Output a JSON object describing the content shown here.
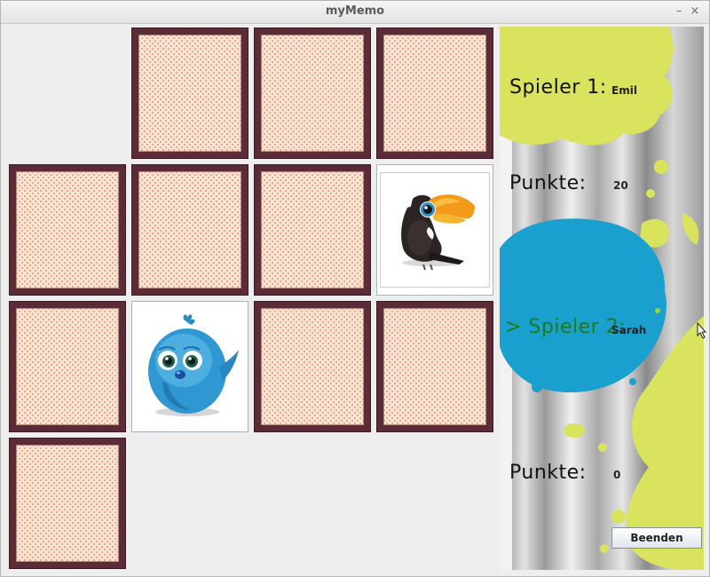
{
  "window": {
    "title": "myMemo",
    "minimize_label": "–",
    "close_label": "×"
  },
  "board": {
    "cards": [
      {
        "id": "r0c1",
        "state": "hidden"
      },
      {
        "id": "r0c2",
        "state": "hidden"
      },
      {
        "id": "r0c3",
        "state": "hidden"
      },
      {
        "id": "r1c0",
        "state": "hidden"
      },
      {
        "id": "r1c1",
        "state": "hidden"
      },
      {
        "id": "r1c2",
        "state": "hidden"
      },
      {
        "id": "r1c3",
        "state": "revealed",
        "image": "toucan-icon"
      },
      {
        "id": "r2c0",
        "state": "hidden"
      },
      {
        "id": "r2c1",
        "state": "revealed",
        "image": "blue-bird-icon"
      },
      {
        "id": "r2c2",
        "state": "hidden"
      },
      {
        "id": "r2c3",
        "state": "hidden"
      },
      {
        "id": "r3c0",
        "state": "hidden"
      }
    ]
  },
  "scoreboard": {
    "player1": {
      "label": "Spieler 1:",
      "name": "Emil",
      "points_label": "Punkte:",
      "points": "20"
    },
    "player2": {
      "label": "> Spieler 2:",
      "name": "Sarah",
      "points_label": "Punkte:",
      "points": "0",
      "active": true
    },
    "end_button": "Beenden"
  },
  "colors": {
    "card_back_frame": "#5b2c37",
    "card_back_pattern": "#f7e5d4",
    "paint_yellow": "#d9e35e",
    "paint_blue": "#1aa0cf",
    "active_player": "#1e7a18"
  }
}
